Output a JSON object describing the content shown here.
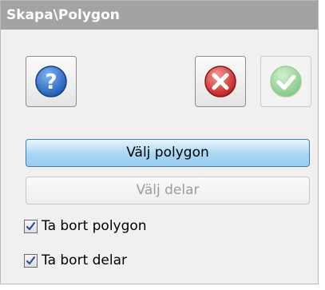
{
  "panel": {
    "title": "Skapa\\Polygon"
  },
  "toolbar": {
    "help_icon": "help-icon",
    "cancel_icon": "cancel-icon",
    "ok_icon": "ok-icon"
  },
  "actions": {
    "select_polygon_label": "Välj polygon",
    "select_parts_label": "Välj delar"
  },
  "options": {
    "remove_polygon_label": "Ta bort polygon",
    "remove_polygon_checked": true,
    "remove_parts_label": "Ta bort delar",
    "remove_parts_checked": true
  },
  "colors": {
    "title_bar": "#a3a3a3",
    "help_blue": "#2f6fc6",
    "cancel_red": "#d63a3a",
    "ok_green": "#8ed08c",
    "primary_blue": "#a8d6f4"
  }
}
